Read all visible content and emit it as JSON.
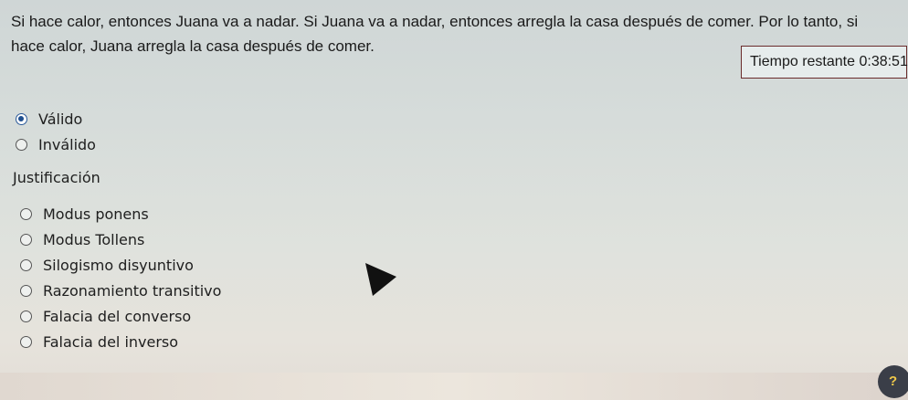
{
  "question": {
    "text": "Si hace calor, entonces Juana va a nadar. Si Juana va a nadar, entonces arregla la casa después de comer. Por lo tanto, si hace calor, Juana arregla la casa después de comer."
  },
  "timer": {
    "label": "Tiempo restante",
    "value": "0:38:51"
  },
  "validity": {
    "options": [
      {
        "label": "Válido",
        "selected": true
      },
      {
        "label": "Inválido",
        "selected": false
      }
    ]
  },
  "justification": {
    "title": "Justificación",
    "options": [
      {
        "label": "Modus ponens",
        "selected": false
      },
      {
        "label": "Modus Tollens",
        "selected": false
      },
      {
        "label": "Silogismo disyuntivo",
        "selected": false
      },
      {
        "label": "Razonamiento transitivo",
        "selected": false
      },
      {
        "label": "Falacia del converso",
        "selected": false
      },
      {
        "label": "Falacia del inverso",
        "selected": false
      }
    ]
  },
  "help": {
    "label": "?"
  }
}
